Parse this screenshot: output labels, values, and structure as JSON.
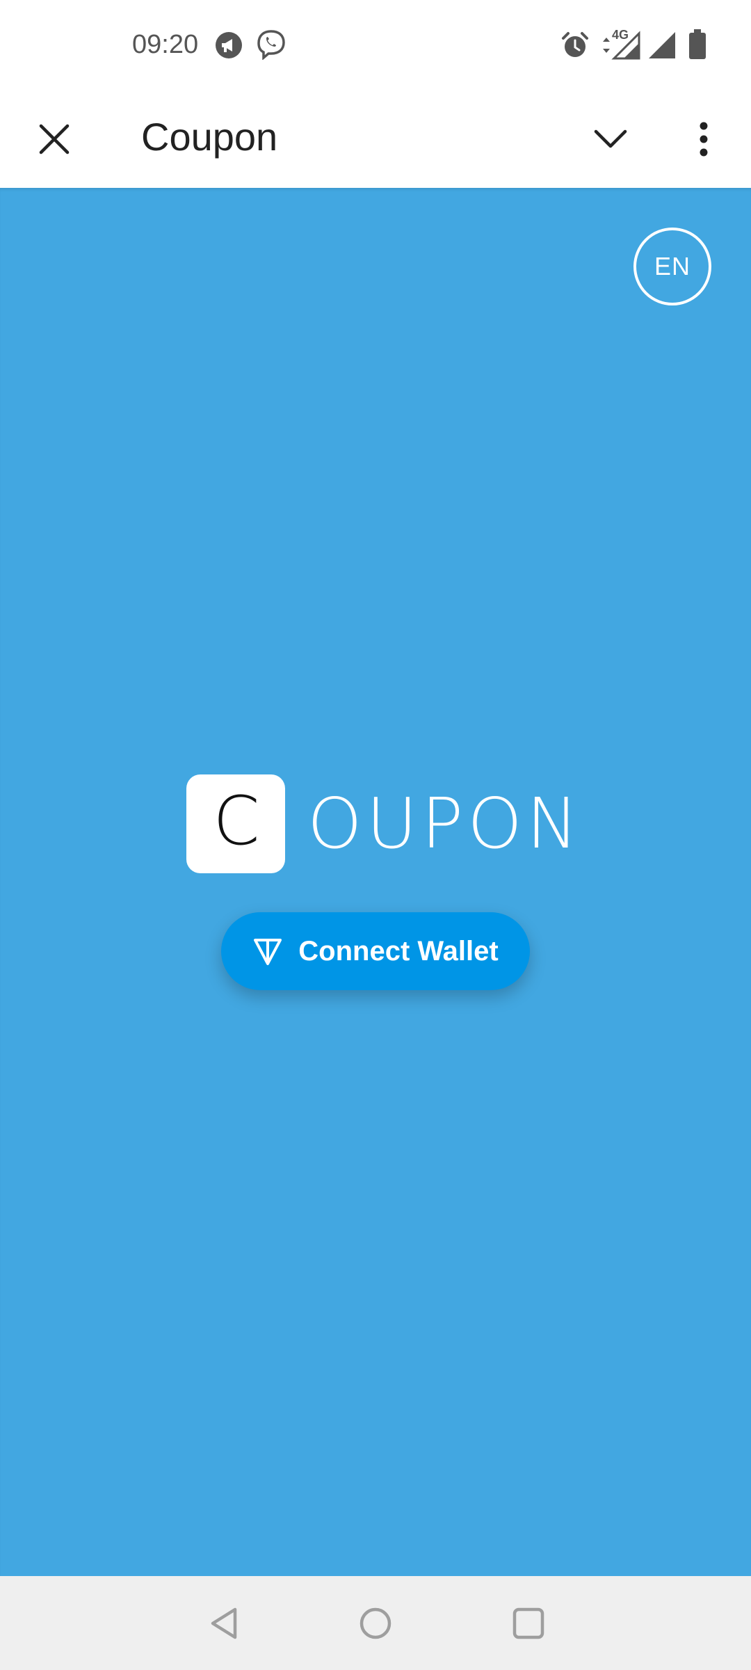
{
  "status_bar": {
    "time": "09:20",
    "network_label": "4G",
    "icons": [
      "megaphone-icon",
      "viber-icon",
      "alarm-icon",
      "signal-4g-icon",
      "signal-icon",
      "battery-icon"
    ]
  },
  "appbar": {
    "title": "Coupon",
    "icons": [
      "close-icon",
      "chevron-down-icon",
      "more-vert-icon"
    ]
  },
  "main": {
    "lang_label": "EN",
    "logo_letter": "C",
    "logo_word": "OUPON",
    "connect_label": "Connect Wallet",
    "connect_icon": "ton-diamond-icon"
  },
  "nav_bar": {
    "icons": [
      "back-icon",
      "home-icon",
      "recents-icon"
    ]
  },
  "colors": {
    "background": "#42a7e1",
    "button": "#0095e6",
    "nav_bar": "#efefef"
  }
}
